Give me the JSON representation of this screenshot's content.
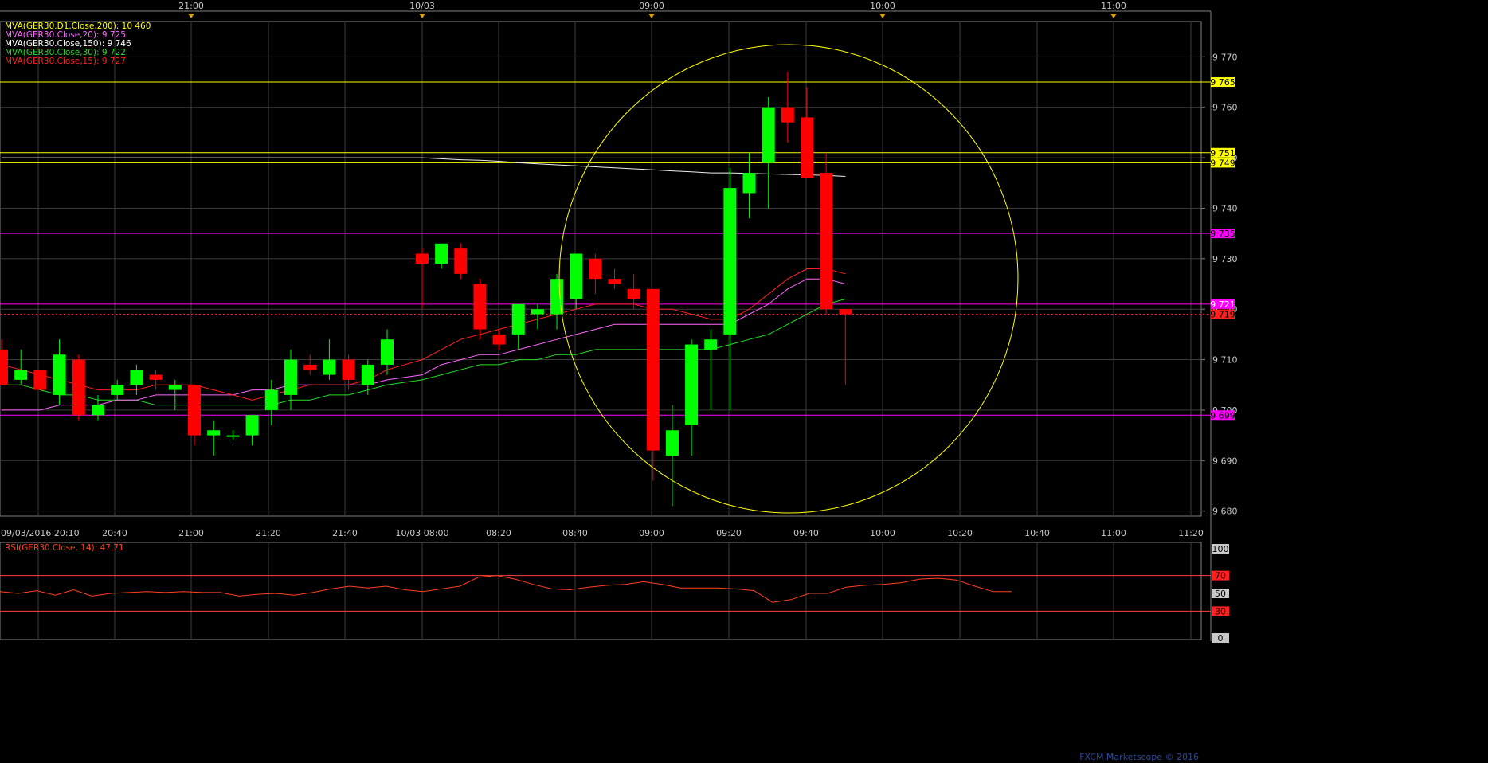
{
  "chart_data": {
    "type": "candlestick",
    "symbol": "GER30",
    "time_labels_bottom": [
      "09/03/2016 20:10",
      "20:40",
      "21:00",
      "21:20",
      "21:40",
      "10/03 08:00",
      "08:20",
      "08:40",
      "09:00",
      "09:20",
      "09:40",
      "10:00",
      "10:20",
      "10:40",
      "11:00",
      "11:20"
    ],
    "time_labels_top": [
      "21:00",
      "10/03",
      "09:00",
      "10:00",
      "11:00"
    ],
    "price_ticks": [
      "9 680",
      "9 690",
      "9 700",
      "9 710",
      "9 720",
      "9 730",
      "9 740",
      "9 750",
      "9 760",
      "9 770"
    ],
    "price_tick_values": [
      9680,
      9690,
      9700,
      9710,
      9720,
      9730,
      9740,
      9750,
      9760,
      9770
    ],
    "ylim": [
      9679,
      9777
    ],
    "legend": [
      {
        "text": "MVA(GER30.D1.Close,200): 10 460",
        "color": "#ffff00"
      },
      {
        "text": "MVA(GER30.Close,20): 9 725",
        "color": "#ff66ff"
      },
      {
        "text": "MVA(GER30.Close,150): 9 746",
        "color": "#ffffff"
      },
      {
        "text": "MVA(GER30.Close,30): 9 722",
        "color": "#22dd22"
      },
      {
        "text": "MVA(GER30.Close,15): 9 727",
        "color": "#ff2020"
      }
    ],
    "candles": [
      {
        "o": 9712,
        "h": 9714,
        "l": 9705,
        "c": 9705
      },
      {
        "o": 9706,
        "h": 9712,
        "l": 9705,
        "c": 9708
      },
      {
        "o": 9708,
        "h": 9708,
        "l": 9704,
        "c": 9704
      },
      {
        "o": 9703,
        "h": 9714,
        "l": 9701,
        "c": 9711
      },
      {
        "o": 9710,
        "h": 9711,
        "l": 9698,
        "c": 9699
      },
      {
        "o": 9699,
        "h": 9703,
        "l": 9698,
        "c": 9701
      },
      {
        "o": 9703,
        "h": 9706,
        "l": 9702,
        "c": 9705
      },
      {
        "o": 9705,
        "h": 9709,
        "l": 9703,
        "c": 9708
      },
      {
        "o": 9707,
        "h": 9708,
        "l": 9704,
        "c": 9706
      },
      {
        "o": 9704,
        "h": 9706,
        "l": 9700,
        "c": 9705
      },
      {
        "o": 9705,
        "h": 9705,
        "l": 9693,
        "c": 9695
      },
      {
        "o": 9695,
        "h": 9698,
        "l": 9691,
        "c": 9696
      },
      {
        "o": 9695,
        "h": 9696,
        "l": 9694,
        "c": 9695
      },
      {
        "o": 9695,
        "h": 9699,
        "l": 9693,
        "c": 9699
      },
      {
        "o": 9700,
        "h": 9706,
        "l": 9697,
        "c": 9704
      },
      {
        "o": 9703,
        "h": 9712,
        "l": 9700,
        "c": 9710
      },
      {
        "o": 9709,
        "h": 9711,
        "l": 9707,
        "c": 9708
      },
      {
        "o": 9707,
        "h": 9714,
        "l": 9706,
        "c": 9710
      },
      {
        "o": 9710,
        "h": 9711,
        "l": 9704,
        "c": 9706
      },
      {
        "o": 9705,
        "h": 9710,
        "l": 9703,
        "c": 9709
      },
      {
        "o": 9709,
        "h": 9716,
        "l": 9707,
        "c": 9714
      },
      {
        "o": 9731,
        "h": 9732,
        "l": 9720,
        "c": 9729
      },
      {
        "o": 9729,
        "h": 9733,
        "l": 9728,
        "c": 9733
      },
      {
        "o": 9732,
        "h": 9733,
        "l": 9726,
        "c": 9727
      },
      {
        "o": 9725,
        "h": 9726,
        "l": 9714,
        "c": 9716
      },
      {
        "o": 9715,
        "h": 9716,
        "l": 9712,
        "c": 9713
      },
      {
        "o": 9715,
        "h": 9721,
        "l": 9712,
        "c": 9721
      },
      {
        "o": 9719,
        "h": 9721,
        "l": 9716,
        "c": 9720
      },
      {
        "o": 9719,
        "h": 9727,
        "l": 9716,
        "c": 9726
      },
      {
        "o": 9722,
        "h": 9731,
        "l": 9720,
        "c": 9731
      },
      {
        "o": 9730,
        "h": 9731,
        "l": 9723,
        "c": 9726
      },
      {
        "o": 9726,
        "h": 9728,
        "l": 9724,
        "c": 9725
      },
      {
        "o": 9724,
        "h": 9727,
        "l": 9720,
        "c": 9722
      },
      {
        "o": 9724,
        "h": 9724,
        "l": 9686,
        "c": 9692
      },
      {
        "o": 9691,
        "h": 9701,
        "l": 9681,
        "c": 9696
      },
      {
        "o": 9697,
        "h": 9714,
        "l": 9691,
        "c": 9713
      },
      {
        "o": 9712,
        "h": 9716,
        "l": 9700,
        "c": 9714
      },
      {
        "o": 9715,
        "h": 9748,
        "l": 9700,
        "c": 9744
      },
      {
        "o": 9743,
        "h": 9751,
        "l": 9738,
        "c": 9747
      },
      {
        "o": 9749,
        "h": 9762,
        "l": 9740,
        "c": 9760
      },
      {
        "o": 9760,
        "h": 9767,
        "l": 9753,
        "c": 9757
      },
      {
        "o": 9758,
        "h": 9764,
        "l": 9746,
        "c": 9746
      },
      {
        "o": 9747,
        "h": 9751,
        "l": 9719,
        "c": 9720
      },
      {
        "o": 9720,
        "h": 9720,
        "l": 9705,
        "c": 9719
      }
    ],
    "mva15": [
      9709,
      9708,
      9707,
      9706,
      9705,
      9704,
      9704,
      9704,
      9705,
      9705,
      9705,
      9704,
      9703,
      9702,
      9703,
      9704,
      9705,
      9705,
      9705,
      9706,
      9708,
      9710,
      9712,
      9714,
      9715,
      9716,
      9717,
      9718,
      9719,
      9720,
      9721,
      9721,
      9721,
      9720,
      9720,
      9719,
      9718,
      9718,
      9720,
      9723,
      9726,
      9728,
      9728,
      9727
    ],
    "mva20": [
      9700,
      9700,
      9700,
      9701,
      9701,
      9701,
      9702,
      9702,
      9703,
      9703,
      9703,
      9703,
      9703,
      9704,
      9704,
      9705,
      9705,
      9705,
      9705,
      9705,
      9706,
      9707,
      9709,
      9710,
      9711,
      9711,
      9712,
      9713,
      9714,
      9715,
      9716,
      9717,
      9717,
      9717,
      9717,
      9717,
      9717,
      9717,
      9719,
      9721,
      9724,
      9726,
      9726,
      9725
    ],
    "mva30": [
      9705,
      9705,
      9704,
      9703,
      9703,
      9702,
      9702,
      9702,
      9701,
      9701,
      9701,
      9701,
      9701,
      9701,
      9701,
      9702,
      9702,
      9703,
      9703,
      9704,
      9705,
      9706,
      9707,
      9708,
      9709,
      9709,
      9710,
      9710,
      9711,
      9711,
      9712,
      9712,
      9712,
      9712,
      9712,
      9712,
      9712,
      9713,
      9714,
      9715,
      9717,
      9719,
      9721,
      9722
    ],
    "mva150": [
      9750,
      9750,
      9750,
      9750,
      9750,
      9750,
      9750,
      9750,
      9750,
      9750,
      9750,
      9750,
      9750,
      9750,
      9750,
      9750,
      9750,
      9750,
      9750,
      9750,
      9750,
      9750,
      9749.8,
      9749.6,
      9749.5,
      9749.3,
      9749,
      9748.8,
      9748.6,
      9748.4,
      9748.2,
      9748,
      9747.8,
      9747.6,
      9747.4,
      9747.2,
      9747,
      9747,
      9746.9,
      9746.8,
      9746.7,
      9746.6,
      9746.5,
      9746.3
    ],
    "hlines": [
      {
        "value": 9765,
        "label": "9 765",
        "color": "#ffff00",
        "label_bg": "#ffff00",
        "label_fg": "#000000",
        "style": "solid"
      },
      {
        "value": 9751,
        "label": "9 751",
        "color": "#ffff00",
        "label_bg": "#ffff00",
        "label_fg": "#000000",
        "style": "solid"
      },
      {
        "value": 9749,
        "label": "9 749",
        "color": "#ffff00",
        "label_bg": "#ffff00",
        "label_fg": "#000000",
        "style": "solid"
      },
      {
        "value": 9735,
        "label": "9 735",
        "color": "#ff00ff",
        "label_bg": "#ff00ff",
        "label_fg": "#000000",
        "style": "solid"
      },
      {
        "value": 9721,
        "label": "9 721",
        "color": "#ff00ff",
        "label_bg": "#ff00ff",
        "label_fg": "#ffffff",
        "style": "solid"
      },
      {
        "value": 9719,
        "label": "9 719",
        "color": "#ff2020",
        "label_bg": "#ff2020",
        "label_fg": "#000000",
        "style": "dotted"
      },
      {
        "value": 9699,
        "label": "9 699",
        "color": "#ff00ff",
        "label_bg": "#ff00ff",
        "label_fg": "#000000",
        "style": "solid"
      }
    ],
    "rsi": {
      "label": "RSI(GER30.Close, 14): 47,71",
      "ticks": [
        "100",
        "70",
        "50",
        "30",
        "0"
      ],
      "tick_values": [
        100,
        70,
        50,
        30,
        0
      ],
      "values": [
        52,
        50,
        53,
        48,
        54,
        47,
        50,
        51,
        52,
        51,
        52,
        51,
        51,
        47,
        49,
        50,
        48,
        51,
        55,
        58,
        56,
        58,
        54,
        52,
        55,
        58,
        68,
        70,
        66,
        60,
        55,
        54,
        57,
        59,
        60,
        63,
        60,
        56,
        56,
        56,
        55,
        53,
        40,
        43,
        50,
        50,
        57,
        59,
        60,
        62,
        66,
        67,
        65,
        58,
        52,
        52
      ]
    },
    "watermark": "FXCM Marketscope © 2016"
  }
}
